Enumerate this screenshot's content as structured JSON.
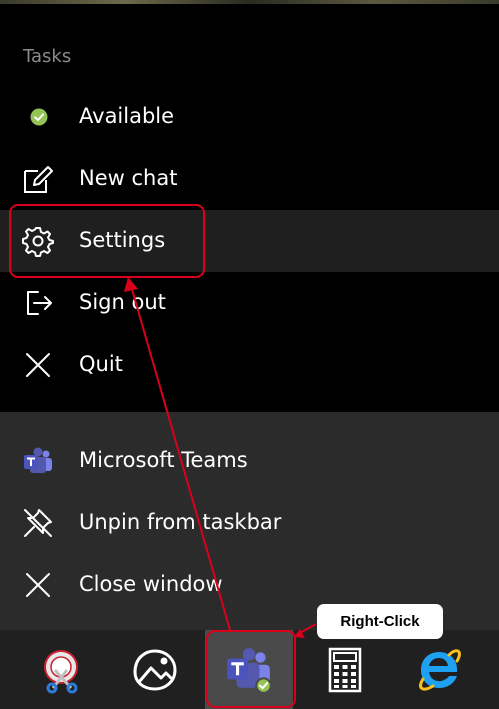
{
  "menu": {
    "section_label": "Tasks",
    "items": [
      {
        "label": "Available",
        "icon": "status-available-icon"
      },
      {
        "label": "New chat",
        "icon": "compose-icon"
      },
      {
        "label": "Settings",
        "icon": "gear-icon"
      },
      {
        "label": "Sign out",
        "icon": "sign-out-icon"
      },
      {
        "label": "Quit",
        "icon": "close-icon"
      }
    ],
    "app_items": [
      {
        "label": "Microsoft Teams",
        "icon": "teams-icon"
      },
      {
        "label": "Unpin from taskbar",
        "icon": "unpin-icon"
      },
      {
        "label": "Close window",
        "icon": "close-icon"
      }
    ]
  },
  "taskbar": {
    "apps": [
      {
        "icon": "snipping-tool-icon"
      },
      {
        "icon": "photos-icon"
      },
      {
        "icon": "teams-icon",
        "active": true
      },
      {
        "icon": "calculator-icon"
      },
      {
        "icon": "internet-explorer-icon"
      }
    ]
  },
  "annotation": {
    "callout": "Right-Click",
    "color": "#d9001b"
  },
  "colors": {
    "available": "#92c353",
    "teams": "#5558af",
    "ie": "#1ea1f1"
  }
}
